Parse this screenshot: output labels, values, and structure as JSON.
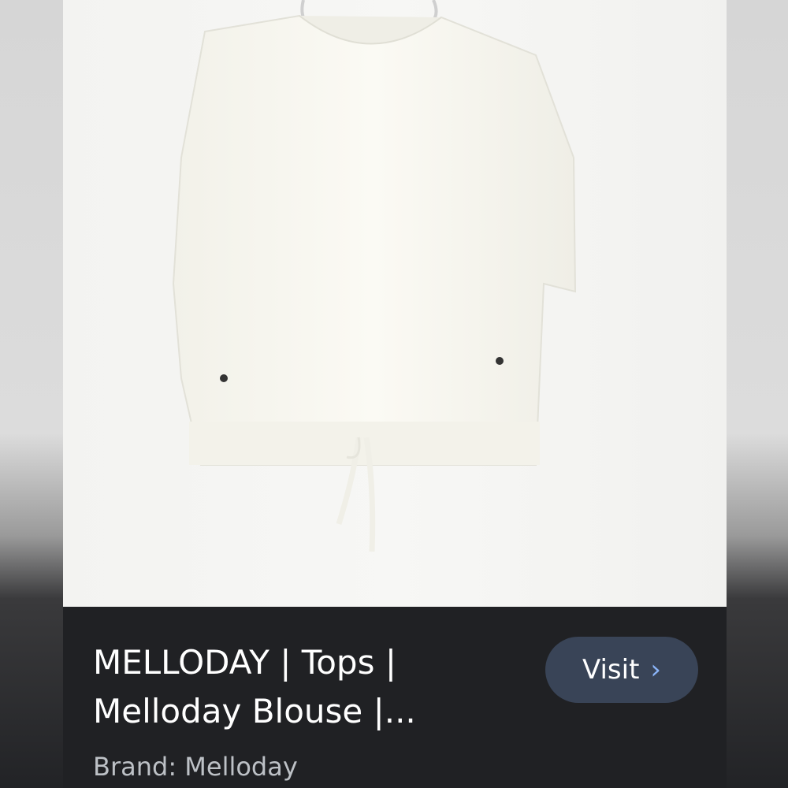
{
  "listing": {
    "title_line1": "MELLODAY | Tops |",
    "title_line2": "Melloday Blouse |...",
    "brand": "Brand: Melloday",
    "visit_label": "Visit",
    "visit_icon": "chevron-right-icon"
  },
  "colors": {
    "card_background": "#202124",
    "button_background": "#394457",
    "chevron": "#8ab4f8",
    "brand_text": "#bdc1c6"
  }
}
